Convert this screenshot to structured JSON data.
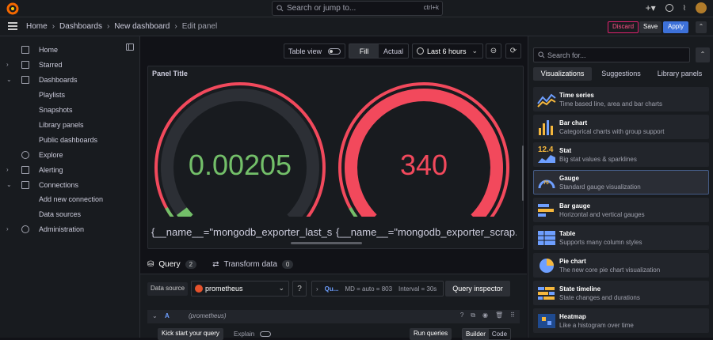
{
  "topbar": {
    "search_placeholder": "Search or jump to...",
    "search_shortcut": "ctrl+k"
  },
  "breadcrumb": {
    "items": [
      "Home",
      "Dashboards",
      "New dashboard"
    ],
    "current": "Edit panel"
  },
  "actions": {
    "discard": "Discard",
    "save": "Save",
    "apply": "Apply"
  },
  "sidebar": {
    "items": [
      {
        "label": "Home",
        "icon": "home-icon",
        "expandable": false
      },
      {
        "label": "Starred",
        "icon": "star-icon",
        "expandable": true
      },
      {
        "label": "Dashboards",
        "icon": "grid-icon",
        "expandable": true,
        "expanded": true
      },
      {
        "label": "Playlists",
        "sub": true
      },
      {
        "label": "Snapshots",
        "sub": true
      },
      {
        "label": "Library panels",
        "sub": true
      },
      {
        "label": "Public dashboards",
        "sub": true
      },
      {
        "label": "Explore",
        "icon": "compass-icon",
        "expandable": false
      },
      {
        "label": "Alerting",
        "icon": "bell-icon",
        "expandable": true
      },
      {
        "label": "Connections",
        "icon": "plug-icon",
        "expandable": true,
        "expanded": true
      },
      {
        "label": "Add new connection",
        "sub": true
      },
      {
        "label": "Data sources",
        "sub": true
      },
      {
        "label": "Administration",
        "icon": "gear-icon",
        "expandable": true
      }
    ]
  },
  "toolbar": {
    "table_view": "Table view",
    "fill": "Fill",
    "actual": "Actual",
    "time_range": "Last 6 hours"
  },
  "panel": {
    "title": "Panel Title",
    "gauges": [
      {
        "value": "0.00205",
        "label": "{__name__=\"mongodb_exporter_last_s...",
        "color": "#73bf69",
        "fraction": 0.03
      },
      {
        "value": "340",
        "label": "{__name__=\"mongodb_exporter_scrap...",
        "color": "#f2495c",
        "fraction": 1.0
      }
    ]
  },
  "query": {
    "tabs": [
      {
        "label": "Query",
        "count": "2"
      },
      {
        "label": "Transform data",
        "count": "0"
      }
    ],
    "data_source_label": "Data source",
    "data_source": "prometheus",
    "options_q": "Qu...",
    "md": "MD = auto = 803",
    "interval": "Interval = 30s",
    "inspector": "Query inspector",
    "row_letter": "A",
    "row_source": "(prometheus)",
    "kick_start": "Kick start your query",
    "explain": "Explain",
    "run": "Run queries",
    "builder": "Builder",
    "code": "Code"
  },
  "viz": {
    "search_placeholder": "Search for...",
    "tabs": [
      "Visualizations",
      "Suggestions",
      "Library panels"
    ],
    "items": [
      {
        "name": "Time series",
        "desc": "Time based line, area and bar charts",
        "icon": "timeseries-icon"
      },
      {
        "name": "Bar chart",
        "desc": "Categorical charts with group support",
        "icon": "barchart-icon"
      },
      {
        "name": "Stat",
        "desc": "Big stat values & sparklines",
        "icon": "stat-icon",
        "icon_text": "12.4"
      },
      {
        "name": "Gauge",
        "desc": "Standard gauge visualization",
        "icon": "gauge-icon",
        "icon_text": "70",
        "selected": true
      },
      {
        "name": "Bar gauge",
        "desc": "Horizontal and vertical gauges",
        "icon": "bargauge-icon"
      },
      {
        "name": "Table",
        "desc": "Supports many column styles",
        "icon": "table-icon"
      },
      {
        "name": "Pie chart",
        "desc": "The new core pie chart visualization",
        "icon": "piechart-icon"
      },
      {
        "name": "State timeline",
        "desc": "State changes and durations",
        "icon": "statetimeline-icon"
      },
      {
        "name": "Heatmap",
        "desc": "Like a histogram over time",
        "icon": "heatmap-icon"
      }
    ]
  },
  "colors": {
    "accent": "#3d71d9",
    "orange": "#f55f3e",
    "green": "#73bf69",
    "red": "#f2495c",
    "bg": "#111217",
    "panel": "#181b1f"
  }
}
